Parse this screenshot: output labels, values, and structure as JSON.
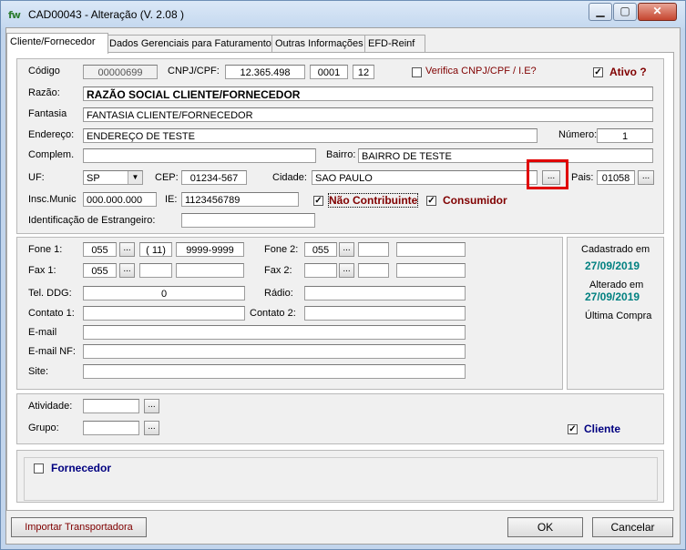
{
  "window": {
    "title": "CAD00043 - Alteração  (V.  2.08 )",
    "app_icon": "fw"
  },
  "tabs": [
    "Cliente/Fornecedor",
    "Dados Gerenciais para Faturamento",
    "Outras Informações",
    "EFD-Reinf"
  ],
  "main": {
    "codigo_label": "Código",
    "codigo_value": "00000699",
    "cnpj_label": "CNPJ/CPF:",
    "cnpj_value": "12.365.498",
    "cnpj_branch": "0001",
    "cnpj_dv": "12",
    "verifica_label": "Verifica CNPJ/CPF / I.E?",
    "verifica_checked": false,
    "ativo_label": "Ativo ?",
    "ativo_checked": true,
    "razao_label": "Razão:",
    "razao_value": "RAZÃO SOCIAL CLIENTE/FORNECEDOR",
    "fantasia_label": "Fantasia",
    "fantasia_value": "FANTASIA CLIENTE/FORNECEDOR",
    "endereco_label": "Endereço:",
    "endereco_value": "ENDEREÇO DE TESTE",
    "numero_label": "Número:",
    "numero_value": "1",
    "complem_label": "Complem.",
    "complem_value": "",
    "bairro_label": "Bairro:",
    "bairro_value": "BAIRRO DE TESTE",
    "uf_label": "UF:",
    "uf_value": "SP",
    "cep_label": "CEP:",
    "cep_value": "01234-567",
    "cidade_label": "Cidade:",
    "cidade_value": "SAO PAULO",
    "pais_label": "Pais:",
    "pais_value": "01058",
    "insc_label": "Insc.Munic",
    "insc_value": "000.000.000",
    "ie_label": "IE:",
    "ie_value": "1123456789",
    "nao_contrib_label": "Não Contribuinte",
    "nao_contrib_checked": true,
    "consumidor_label": "Consumidor",
    "consumidor_checked": true,
    "ident_estrang_label": "Identificação de Estrangeiro:",
    "ident_estrang_value": "",
    "ellipsis": "..."
  },
  "contact": {
    "fone1_label": "Fone 1:",
    "fone1_ddi": "055",
    "fone1_ddd": "( 11)",
    "fone1_num": "9999-9999",
    "fone2_label": "Fone 2:",
    "fone2_ddi": "055",
    "fone2_ddd": "",
    "fone2_num": "",
    "fax1_label": "Fax 1:",
    "fax1_ddi": "055",
    "fax1_ddd": "",
    "fax1_num": "",
    "fax2_label": "Fax 2:",
    "fax2_ddi": "",
    "fax2_ddd": "",
    "fax2_num": "",
    "teldg_label": "Tel. DDG:",
    "teldg_value": "0",
    "radio_label": "Rádio:",
    "radio_value": "",
    "contato1_label": "Contato 1:",
    "contato1_value": "",
    "contato2_label": "Contato 2:",
    "contato2_value": "",
    "email_label": "E-mail",
    "email_value": "",
    "emailnf_label": "E-mail NF:",
    "emailnf_value": "",
    "site_label": "Site:",
    "site_value": ""
  },
  "info": {
    "cadastrado_label": "Cadastrado em",
    "cadastrado_date": "27/09/2019",
    "alterado_label": "Alterado em",
    "alterado_date": "27/09/2019",
    "ultima_compra_label": "Última Compra"
  },
  "activity": {
    "atividade_label": "Atividade:",
    "atividade_value": "",
    "grupo_label": "Grupo:",
    "grupo_value": "",
    "cliente_label": "Cliente",
    "cliente_checked": true
  },
  "fornecedor": {
    "label": "Fornecedor",
    "checked": false
  },
  "footer": {
    "importar_label": "Importar Transportadora",
    "ok_label": "OK",
    "cancelar_label": "Cancelar"
  },
  "check_mark": "✓"
}
